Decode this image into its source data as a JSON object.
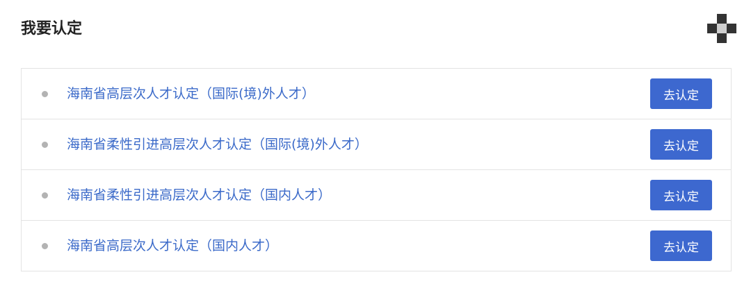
{
  "header": {
    "title": "我要认定",
    "icon": "qr-code-icon"
  },
  "list": {
    "items": [
      {
        "label": "海南省高层次人才认定（国际(境)外人才）",
        "button": "去认定"
      },
      {
        "label": "海南省柔性引进高层次人才认定（国际(境)外人才）",
        "button": "去认定"
      },
      {
        "label": "海南省柔性引进高层次人才认定（国内人才）",
        "button": "去认定"
      },
      {
        "label": "海南省高层次人才认定（国内人才）",
        "button": "去认定"
      }
    ]
  },
  "colors": {
    "link": "#3b6ac9",
    "button": "#3d68cf",
    "bullet": "#b3b3b3",
    "border": "#e3e3e3"
  }
}
